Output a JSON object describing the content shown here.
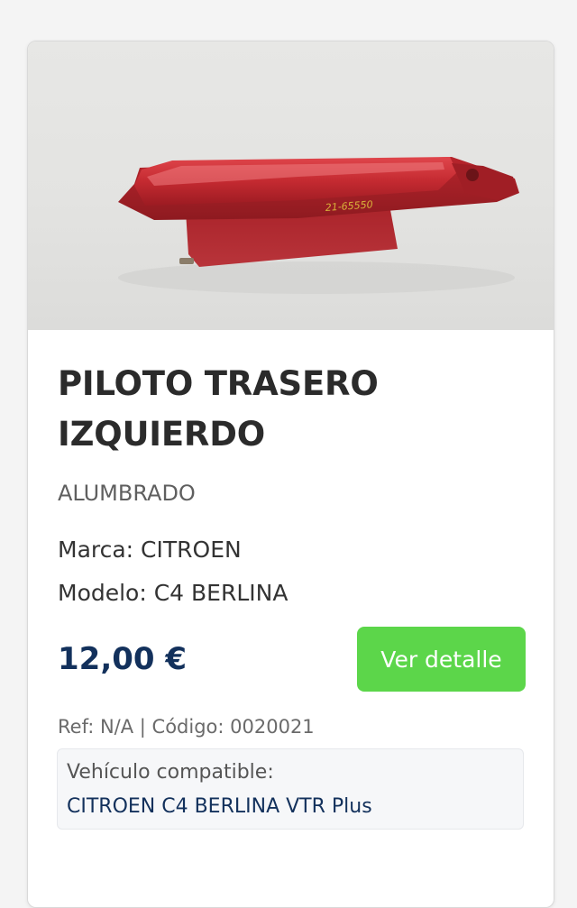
{
  "product": {
    "title": "PILOTO TRASERO IZQUIERDO",
    "category": "ALUMBRADO",
    "brand_line": "Marca: CITROEN",
    "model_line": "Modelo: C4 BERLINA",
    "price": "12,00 €",
    "detail_button_label": "Ver detalle",
    "ref_line": "Ref: N/A | Código: 0020021",
    "compat_label": "Vehículo compatible:",
    "compat_value": "CITROEN C4 BERLINA VTR Plus",
    "image_handwriting": "21-65550"
  },
  "colors": {
    "price": "#13315c",
    "button_bg": "#5cd64a",
    "button_text": "#ffffff",
    "title": "#2b2b2b",
    "lamp_red": "#c0242b"
  }
}
